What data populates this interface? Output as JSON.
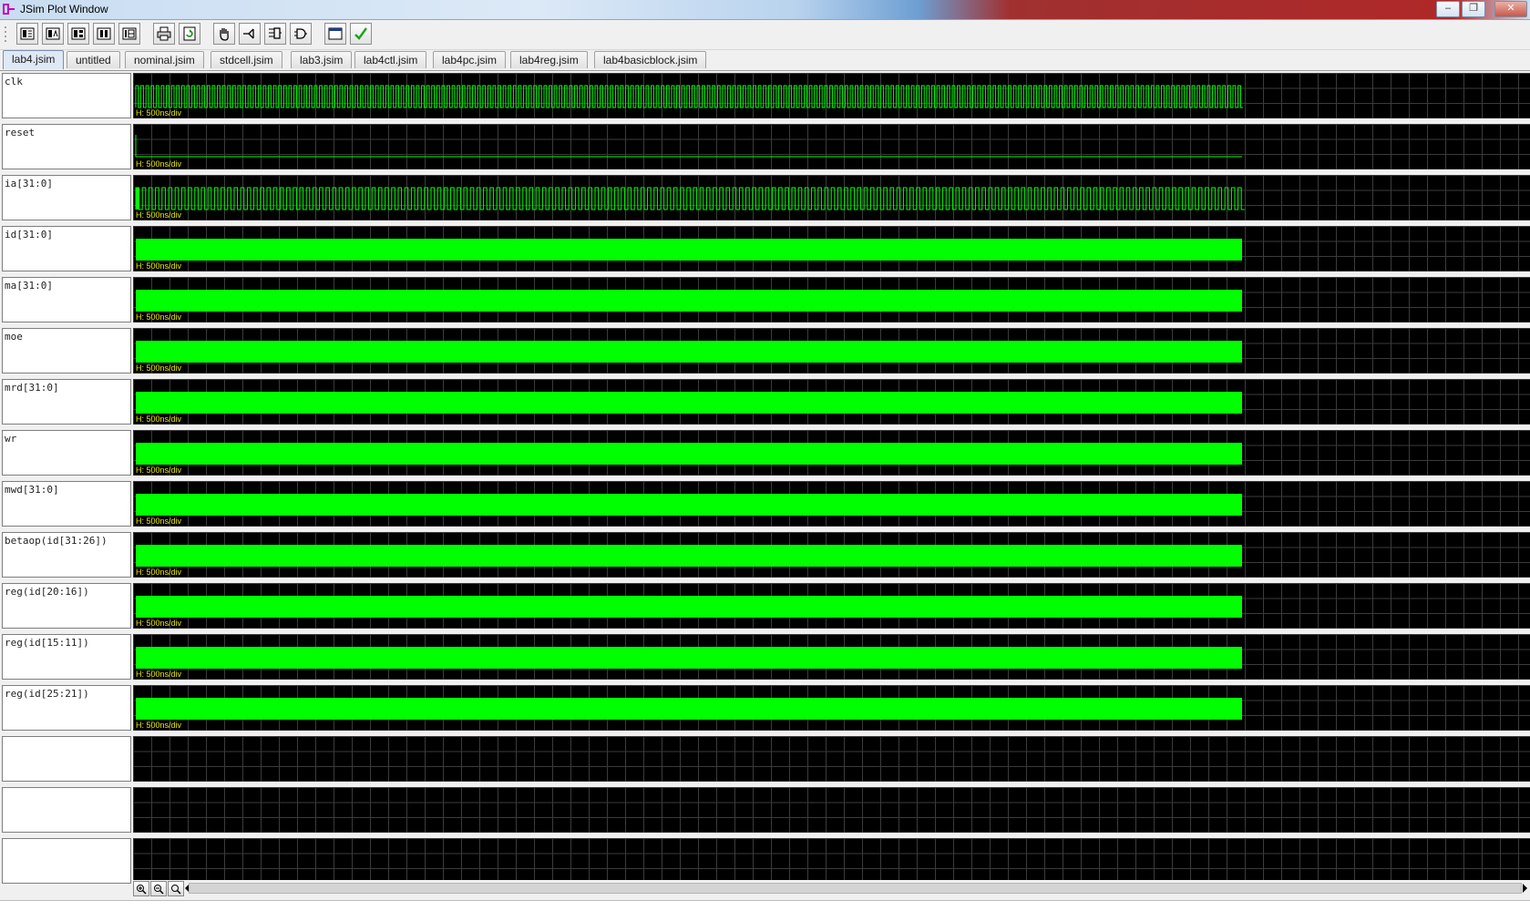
{
  "window": {
    "title": "JSim Plot Window",
    "controls": [
      "minimize",
      "maximize",
      "close"
    ]
  },
  "toolbar": {
    "buttons": [
      {
        "name": "layout-1-icon"
      },
      {
        "name": "layout-2-icon"
      },
      {
        "name": "layout-3-icon"
      },
      {
        "name": "layout-4-icon"
      },
      {
        "name": "layout-5-icon"
      },
      {
        "name": "print-icon"
      },
      {
        "name": "refresh-icon"
      },
      {
        "name": "hand-icon"
      },
      {
        "name": "fork-icon"
      },
      {
        "name": "gate-list-icon"
      },
      {
        "name": "and-gate-icon"
      },
      {
        "name": "window-icon"
      },
      {
        "name": "checkmark-icon"
      }
    ]
  },
  "tabs": [
    {
      "label": "lab4.jsim",
      "active": true
    },
    {
      "label": "untitled",
      "active": false
    },
    {
      "label": "nominal.jsim",
      "active": false
    },
    {
      "label": "stdcell.jsim",
      "active": false
    },
    {
      "label": "lab3.jsim",
      "active": false
    },
    {
      "label": "lab4ctl.jsim",
      "active": false
    },
    {
      "label": "lab4pc.jsim",
      "active": false
    },
    {
      "label": "lab4reg.jsim",
      "active": false
    },
    {
      "label": "lab4basicblock.jsim",
      "active": false
    }
  ],
  "signals": [
    {
      "name": "clk",
      "scale": "H: 500ns/div",
      "kind": "clock"
    },
    {
      "name": "reset",
      "scale": "H: 500ns/div",
      "kind": "pulse"
    },
    {
      "name": "ia[31:0]",
      "scale": "H: 500ns/div",
      "kind": "clock"
    },
    {
      "name": "id[31:0]",
      "scale": "H: 500ns/div",
      "kind": "bus"
    },
    {
      "name": "ma[31:0]",
      "scale": "H: 500ns/div",
      "kind": "bus"
    },
    {
      "name": "moe",
      "scale": "H: 500ns/div",
      "kind": "bus"
    },
    {
      "name": "mrd[31:0]",
      "scale": "H: 500ns/div",
      "kind": "bus"
    },
    {
      "name": "wr",
      "scale": "H: 500ns/div",
      "kind": "bus"
    },
    {
      "name": "mwd[31:0]",
      "scale": "H: 500ns/div",
      "kind": "bus"
    },
    {
      "name": "betaop(id[31:26])",
      "scale": "H: 500ns/div",
      "kind": "bus"
    },
    {
      "name": "reg(id[20:16])",
      "scale": "H: 500ns/div",
      "kind": "bus"
    },
    {
      "name": "reg(id[15:11])",
      "scale": "H: 500ns/div",
      "kind": "bus"
    },
    {
      "name": "reg(id[25:21])",
      "scale": "H: 500ns/div",
      "kind": "bus"
    },
    {
      "name": "",
      "scale": "",
      "kind": "empty"
    },
    {
      "name": "",
      "scale": "",
      "kind": "empty"
    },
    {
      "name": "",
      "scale": "",
      "kind": "empty"
    }
  ],
  "zoom": {
    "buttons": [
      "zoom-in-icon",
      "zoom-out-icon",
      "zoom-fit-icon"
    ]
  },
  "colors": {
    "trace": "#00ff00",
    "plot_background": "#000000",
    "scale_text": "#e8e800"
  }
}
